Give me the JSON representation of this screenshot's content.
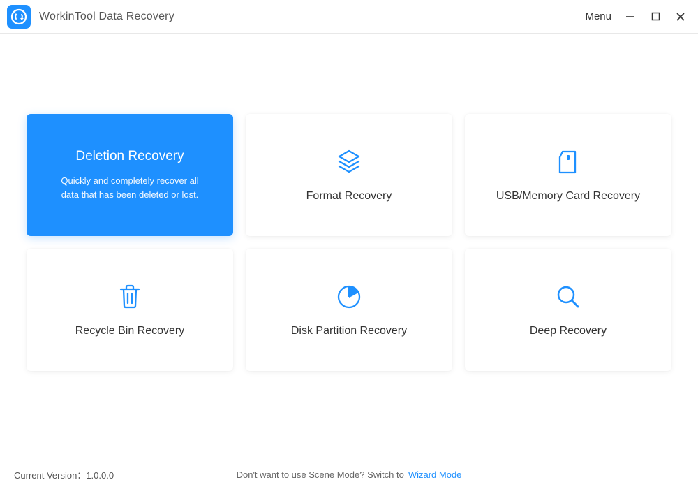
{
  "app": {
    "title": "WorkinTool Data Recovery"
  },
  "titlebar": {
    "menu_label": "Menu"
  },
  "cards": {
    "deletion": {
      "title": "Deletion Recovery",
      "desc": "Quickly and completely recover all data that has been deleted or lost."
    },
    "format": {
      "title": "Format Recovery"
    },
    "usb": {
      "title": "USB/Memory Card Recovery"
    },
    "recycle": {
      "title": "Recycle Bin Recovery"
    },
    "partition": {
      "title": "Disk Partition Recovery"
    },
    "deep": {
      "title": "Deep Recovery"
    }
  },
  "footer": {
    "version_label": "Current Version：",
    "version_value": "1.0.0.0",
    "switch_text": "Don't want to use Scene Mode? Switch to",
    "switch_link": "Wizard Mode"
  }
}
